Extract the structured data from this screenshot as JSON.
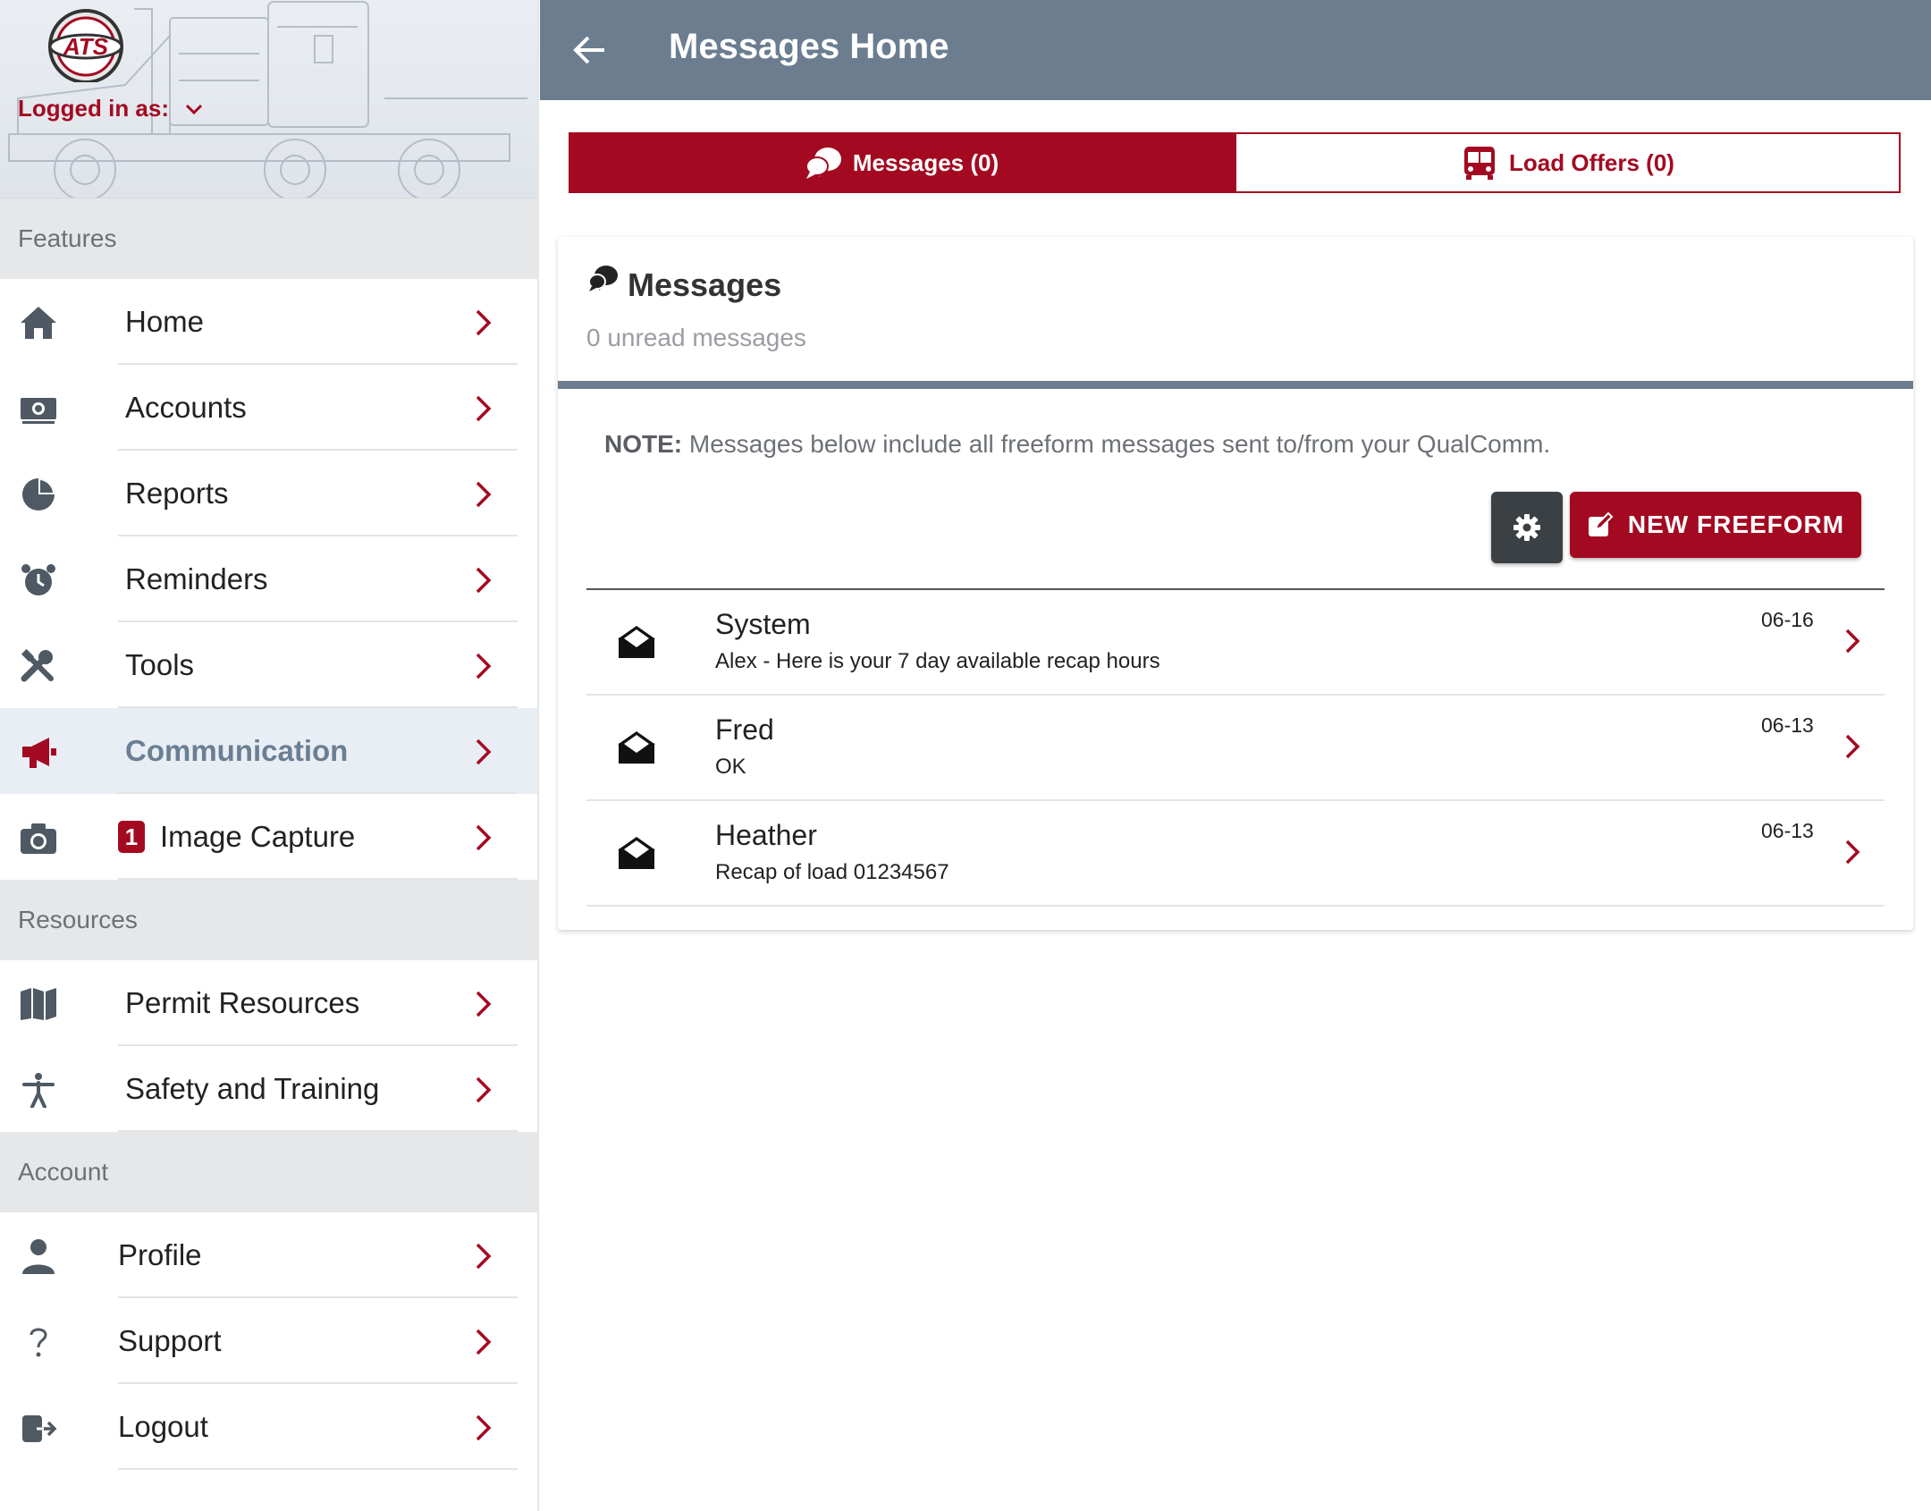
{
  "colors": {
    "brand_red": "#a30a21",
    "topbar": "#6b7d8f",
    "dark_button": "#3b4045"
  },
  "sidebar": {
    "logo_text": "ATS",
    "logged_in_label": "Logged in as:",
    "sections": [
      {
        "title": "Features",
        "items": [
          {
            "label": "Home",
            "icon": "home-icon"
          },
          {
            "label": "Accounts",
            "icon": "money-icon"
          },
          {
            "label": "Reports",
            "icon": "pie-chart-icon"
          },
          {
            "label": "Reminders",
            "icon": "alarm-clock-icon"
          },
          {
            "label": "Tools",
            "icon": "tools-icon"
          },
          {
            "label": "Communication",
            "icon": "megaphone-icon",
            "active": true
          },
          {
            "label": "Image Capture",
            "icon": "camera-icon",
            "badge": "1"
          }
        ]
      },
      {
        "title": "Resources",
        "items": [
          {
            "label": "Permit Resources",
            "icon": "map-icon"
          },
          {
            "label": "Safety and Training",
            "icon": "accessibility-icon"
          }
        ]
      },
      {
        "title": "Account",
        "items": [
          {
            "label": "Profile",
            "icon": "user-icon"
          },
          {
            "label": "Support",
            "icon": "question-icon"
          },
          {
            "label": "Logout",
            "icon": "logout-icon"
          }
        ]
      }
    ]
  },
  "header": {
    "title": "Messages Home",
    "back_icon": "arrow-left-icon"
  },
  "tabs": [
    {
      "label": "Messages (0)",
      "icon": "chat-bubbles-icon",
      "active": true
    },
    {
      "label": "Load Offers (0)",
      "icon": "bus-icon",
      "active": false
    }
  ],
  "messages_card": {
    "title": "Messages",
    "subtitle": "0 unread messages",
    "note_label": "NOTE:",
    "note_text": " Messages below include all freeform messages sent to/from your QualComm.",
    "settings_icon": "gear-icon",
    "new_button_label": "NEW FREEFORM",
    "new_button_icon": "edit-icon"
  },
  "messages": [
    {
      "sender": "System",
      "preview": "Alex - Here is your 7 day available recap hours",
      "date": "06-16"
    },
    {
      "sender": "Fred",
      "preview": "OK",
      "date": "06-13"
    },
    {
      "sender": "Heather",
      "preview": "Recap of load 01234567",
      "date": "06-13"
    }
  ]
}
